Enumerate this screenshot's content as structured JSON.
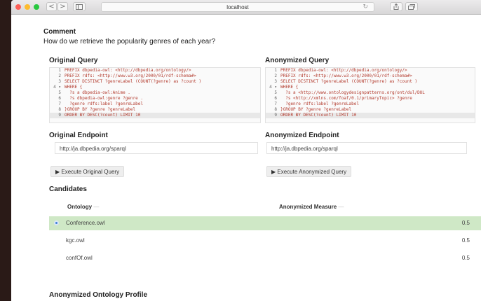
{
  "browser": {
    "url": "localhost",
    "back_icon": "<",
    "forward_icon": ">",
    "reload_icon": "↻"
  },
  "comment": {
    "heading": "Comment",
    "text": "How do we retrieve the popularity genres of each year?"
  },
  "original": {
    "title": "Original Query",
    "lines": [
      "PREFIX dbpedia-owl: <http://dbpedia.org/ontology/>",
      "PREFIX rdfs: <http://www.w3.org/2000/01/rdf-schema#>",
      "SELECT DISTINCT ?genreLabel (COUNT(?genre) as ?count )",
      "WHERE {",
      "  ?s a dbpedia-owl:Anime .",
      "  ?s dbpedia-owl:genre ?genre .",
      "  ?genre rdfs:label ?genreLabel",
      "}GROUP BY ?genre ?genreLabel",
      "ORDER BY DESC(?count) LIMIT 10"
    ],
    "line_numbers": [
      "1",
      "2",
      "3",
      "4 ▾",
      "5",
      "6",
      "7",
      "8",
      "9"
    ],
    "endpoint_title": "Original Endpoint",
    "endpoint_value": "http://ja.dbpedia.org/sparql",
    "execute_label": "▶ Execute Original Query"
  },
  "anonymized": {
    "title": "Anonymized Query",
    "lines": [
      "PREFIX dbpedia-owl: <http://dbpedia.org/ontology/>",
      "PREFIX rdfs: <http://www.w3.org/2000/01/rdf-schema#>",
      "SELECT DISTINCT ?genreLabel (COUNT(?genre) as ?count )",
      "WHERE {",
      "  ?s a <http://www.ontologydesignpatterns.org/ont/dul/DUL",
      "  ?s <http://xmlns.com/foaf/0.1/primaryTopic> ?genre",
      "  ?genre rdfs:label ?genreLabel",
      "}GROUP BY ?genre ?genreLabel",
      "ORDER BY DESC(?count) LIMIT 10"
    ],
    "line_numbers": [
      "1",
      "2",
      "3",
      "4 ▾",
      "5",
      "6",
      "7",
      "8",
      "9"
    ],
    "endpoint_title": "Anonymized Endpoint",
    "endpoint_value": "http://ja.dbpedia.org/sparql",
    "execute_label": "▶ Execute Anonymized Query"
  },
  "candidates": {
    "title": "Candidates",
    "col_ontology": "Ontology",
    "col_measure": "Anonymized Measure",
    "rows": [
      {
        "name": "Conference.owl",
        "score": "0.5"
      },
      {
        "name": "kgc.owl",
        "score": "0.5"
      },
      {
        "name": "confOf.owl",
        "score": "0.5"
      }
    ]
  },
  "profile": {
    "title": "Anonymized Ontology Profile"
  }
}
